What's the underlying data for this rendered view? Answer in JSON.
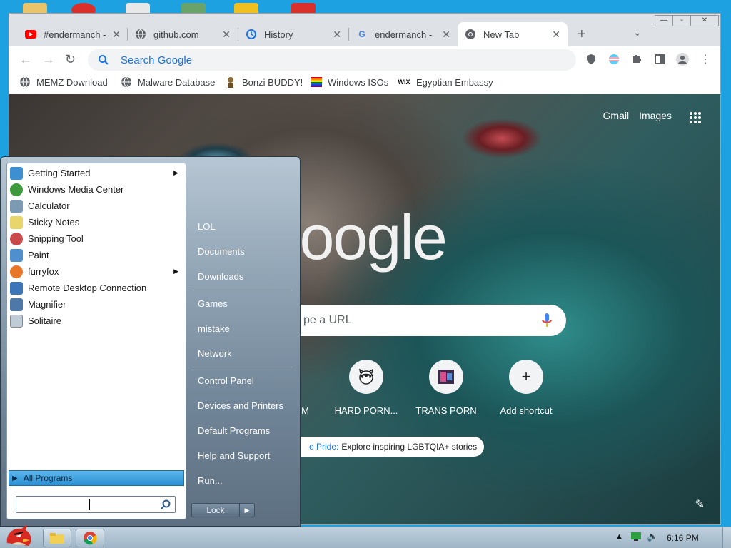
{
  "browser": {
    "tabs": [
      {
        "title": "#endermanch -",
        "favicon": "youtube-icon"
      },
      {
        "title": "github.com",
        "favicon": "globe-icon"
      },
      {
        "title": "History",
        "favicon": "history-icon"
      },
      {
        "title": "endermanch - ",
        "favicon": "google-icon"
      },
      {
        "title": "New Tab",
        "favicon": "chrome-icon",
        "active": true
      }
    ],
    "omnibox": {
      "placeholder": "Search Google"
    },
    "bookmarks": [
      {
        "label": "MEMZ Download",
        "icon": "globe-icon"
      },
      {
        "label": "Malware Database",
        "icon": "globe-icon"
      },
      {
        "label": "Bonzi BUDDY!",
        "icon": "bonzi-icon"
      },
      {
        "label": "Windows ISOs",
        "icon": "rainbow-flag-icon"
      },
      {
        "label": "Egyptian Embassy",
        "icon": "wix-icon"
      }
    ]
  },
  "newtab": {
    "links": {
      "gmail": "Gmail",
      "images": "Images"
    },
    "logo": "Google",
    "search_placeholder": "pe a URL",
    "shortcuts": [
      {
        "label": "M",
        "icon": ""
      },
      {
        "label": "HARD PORN...",
        "icon": "raccoon-icon"
      },
      {
        "label": "TRANS PORN",
        "icon": "image-icon"
      },
      {
        "label": "Add shortcut",
        "icon": "+"
      }
    ],
    "promo": {
      "highlight": "e Pride:",
      "text": "Explore inspiring LGBTQIA+ stories"
    }
  },
  "startmenu": {
    "programs": [
      {
        "label": "Getting Started",
        "submenu": true,
        "color": "#3d8fd1"
      },
      {
        "label": "Windows Media Center",
        "submenu": false,
        "color": "#3c9a3c"
      },
      {
        "label": "Calculator",
        "submenu": false,
        "color": "#7c9ab4"
      },
      {
        "label": "Sticky Notes",
        "submenu": false,
        "color": "#e8d66a"
      },
      {
        "label": "Snipping Tool",
        "submenu": false,
        "color": "#c84a4a"
      },
      {
        "label": "Paint",
        "submenu": false,
        "color": "#4f8fce"
      },
      {
        "label": "furryfox",
        "submenu": true,
        "color": "#e8772a"
      },
      {
        "label": "Remote Desktop Connection",
        "submenu": false,
        "color": "#3c76b8"
      },
      {
        "label": "Magnifier",
        "submenu": false,
        "color": "#4e78a8"
      },
      {
        "label": "Solitaire",
        "submenu": false,
        "color": "#bfcbd6"
      }
    ],
    "all_programs": "All Programs",
    "right_group1": [
      "LOL",
      "Documents",
      "Downloads"
    ],
    "right_group2": [
      "Games",
      "mistake",
      "Network"
    ],
    "right_group3": [
      "Control Panel",
      "Devices and Printers",
      "Default Programs",
      "Help and Support",
      "Run..."
    ],
    "lock_label": "Lock"
  },
  "taskbar": {
    "clock": "6:16 PM"
  }
}
